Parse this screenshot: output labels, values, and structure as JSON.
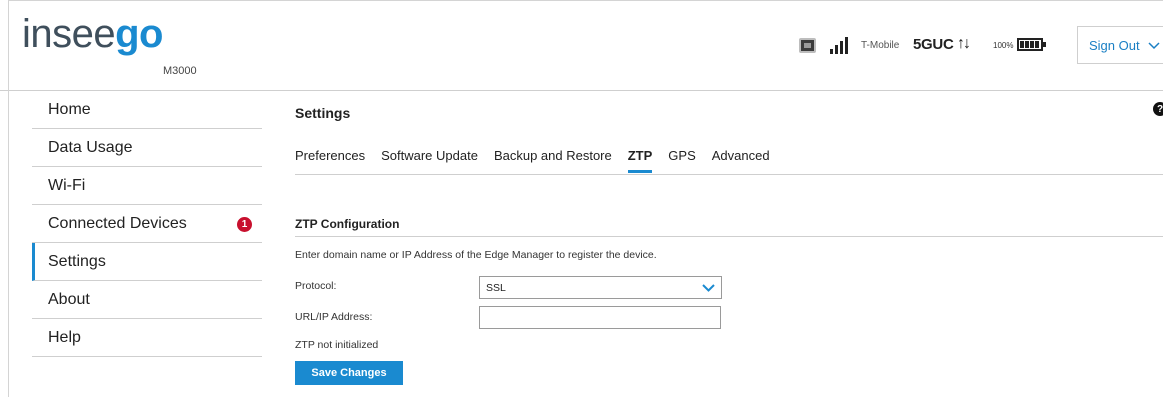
{
  "header": {
    "brand_main": "insee",
    "brand_accent": "go",
    "model": "M3000",
    "carrier": "T-Mobile",
    "network": "5GUC",
    "arrows": "↑↓",
    "battery_pct": "100%",
    "signout_label": "Sign Out",
    "brand_color": "#1a8ad0"
  },
  "sidebar": {
    "items": [
      {
        "label": "Home"
      },
      {
        "label": "Data Usage"
      },
      {
        "label": "Wi-Fi"
      },
      {
        "label": "Connected Devices",
        "badge": "1"
      },
      {
        "label": "Settings",
        "active": true
      },
      {
        "label": "About"
      },
      {
        "label": "Help"
      }
    ]
  },
  "main": {
    "title": "Settings",
    "help_glyph": "?",
    "tabs": [
      {
        "label": "Preferences"
      },
      {
        "label": "Software Update"
      },
      {
        "label": "Backup and Restore"
      },
      {
        "label": "ZTP",
        "active": true
      },
      {
        "label": "GPS"
      },
      {
        "label": "Advanced"
      }
    ],
    "section_title": "ZTP Configuration",
    "description": "Enter domain name or IP Address of the Edge Manager to register the device.",
    "protocol_label": "Protocol:",
    "protocol_value": "SSL",
    "url_label": "URL/IP Address:",
    "url_value": "",
    "status": "ZTP not initialized",
    "save_label": "Save Changes"
  }
}
